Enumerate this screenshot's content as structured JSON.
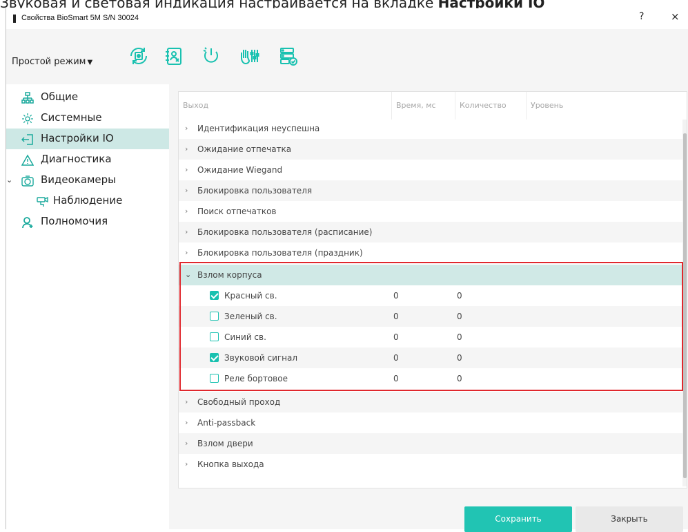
{
  "page_caption": {
    "prefix": "Звуковая и световая индикация настраивается на вкладке ",
    "bold": "Настройки IO"
  },
  "window": {
    "title": "Свойства BioSmart 5M S/N 30024",
    "help": "?",
    "close": "×"
  },
  "toolbar": {
    "mode_label": "Простой режим",
    "caret": "▼",
    "icons": [
      "sync-chip-icon",
      "contact-card-icon",
      "power-icon",
      "hand-sliders-icon",
      "server-check-icon"
    ]
  },
  "sidebar": {
    "toggle": "⌄",
    "items": [
      {
        "label": "Общие",
        "icon": "network-icon"
      },
      {
        "label": "Системные",
        "icon": "gear-icon"
      },
      {
        "label": "Настройки IO",
        "icon": "signin-icon",
        "active": true
      },
      {
        "label": "Диагностика",
        "icon": "warning-icon"
      },
      {
        "label": "Видеокамеры",
        "icon": "camera-icon"
      },
      {
        "label": "Наблюдение",
        "icon": "cctv-icon"
      },
      {
        "label": "Полномочия",
        "icon": "user-add-icon"
      }
    ]
  },
  "table": {
    "headers": [
      "Выход",
      "Время, мс",
      "Количество",
      "Уровень"
    ],
    "collapsed_chevron": "›",
    "expanded_chevron": "⌄",
    "rows_before": [
      "Идентификация неуспешна",
      "Ожидание отпечатка",
      "Ожидание Wiegand",
      "Блокировка пользователя",
      "Поиск отпечатков",
      "Блокировка пользователя (расписание)",
      "Блокировка пользователя (праздник)"
    ],
    "expanded_row": "Взлом корпуса",
    "children": [
      {
        "label": "Красный св.",
        "checked": true,
        "time": "0",
        "count": "0"
      },
      {
        "label": "Зеленый св.",
        "checked": false,
        "time": "0",
        "count": "0"
      },
      {
        "label": "Синий св.",
        "checked": false,
        "time": "0",
        "count": "0"
      },
      {
        "label": "Звуковой сигнал",
        "checked": true,
        "time": "0",
        "count": "0"
      },
      {
        "label": "Реле бортовое",
        "checked": false,
        "time": "0",
        "count": "0"
      }
    ],
    "rows_after": [
      "Свободный проход",
      "Anti-passback",
      "Взлом двери",
      "Кнопка выхода"
    ]
  },
  "buttons": {
    "save": "Сохранить",
    "close": "Закрыть"
  },
  "colors": {
    "accent": "#21c4b3",
    "selected_row": "#d0e9e6",
    "highlight_border": "#e0272d"
  }
}
